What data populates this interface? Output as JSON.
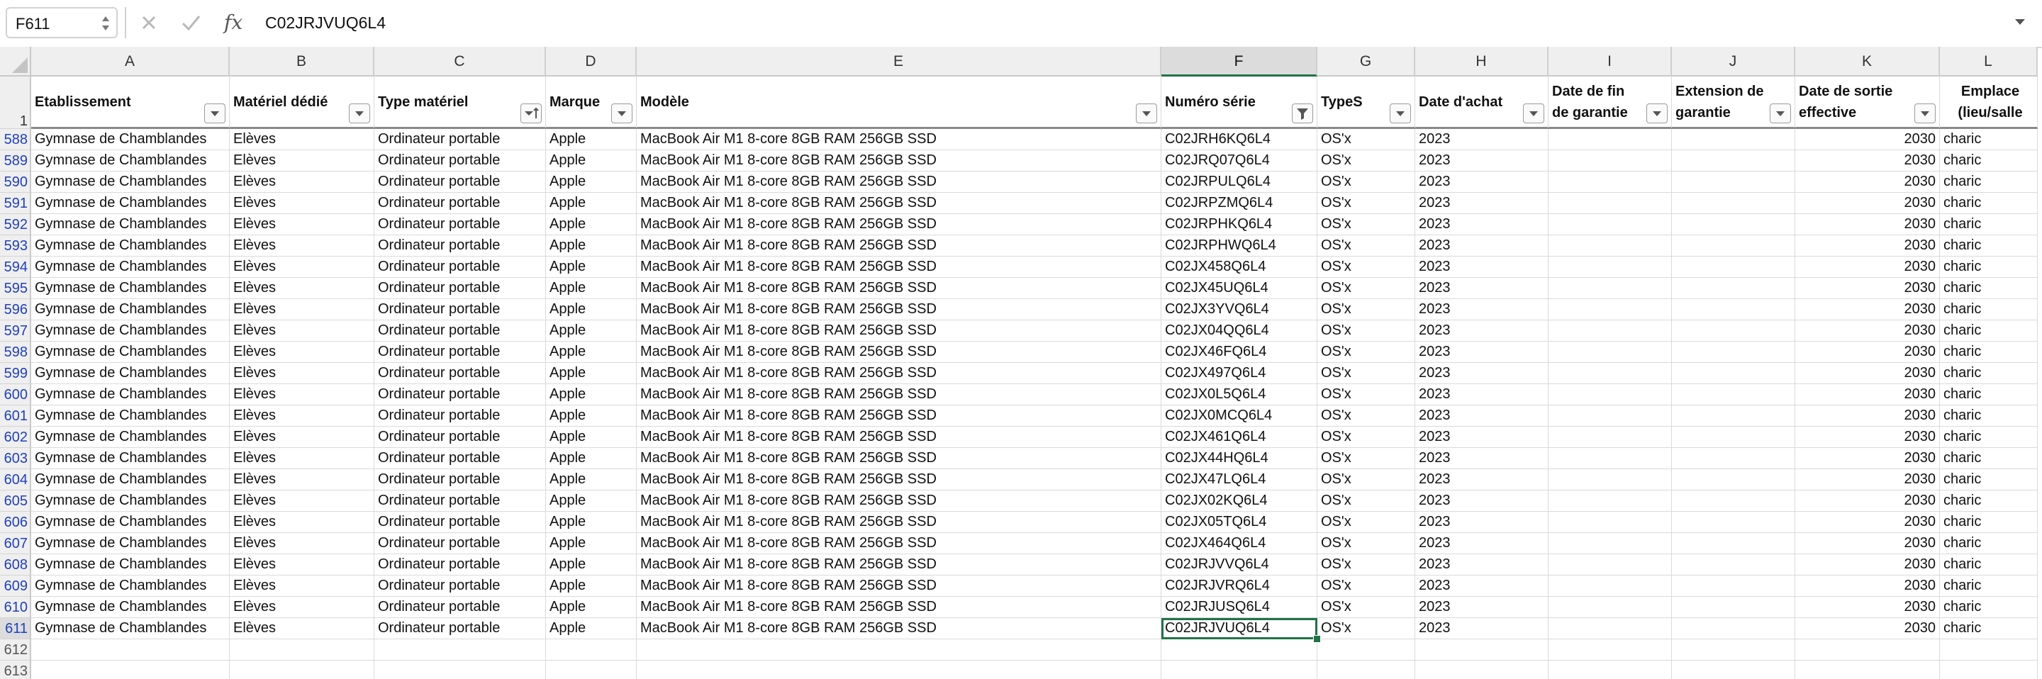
{
  "formula_bar": {
    "name_box": "F611",
    "cancel_icon": "close-icon",
    "enter_icon": "check-icon",
    "fx_label": "fx",
    "formula_value": "C02JRJVUQ6L4"
  },
  "columns": [
    {
      "letter": "A",
      "header": "Etablissement"
    },
    {
      "letter": "B",
      "header": "Matériel dédié"
    },
    {
      "letter": "C",
      "header": "Type matériel"
    },
    {
      "letter": "D",
      "header": "Marque"
    },
    {
      "letter": "E",
      "header": "Modèle"
    },
    {
      "letter": "F",
      "header": "Numéro série"
    },
    {
      "letter": "G",
      "header": "TypeS"
    },
    {
      "letter": "H",
      "header": "Date d'achat"
    },
    {
      "letter": "I",
      "header": "Date de fin de garantie"
    },
    {
      "letter": "J",
      "header": "Extension de garantie"
    },
    {
      "letter": "K",
      "header": "Date de sortie effective"
    },
    {
      "letter": "L",
      "header": "Emplace (lieu/salle"
    }
  ],
  "header_row_number": "1",
  "selected_cell": {
    "column": "F",
    "row": "611"
  },
  "rows": [
    {
      "n": "588",
      "cells": [
        "Gymnase de Chamblandes",
        "Elèves",
        "Ordinateur portable",
        "Apple",
        "MacBook Air M1 8-core 8GB RAM 256GB SSD",
        "C02JRH6KQ6L4",
        "OS'x",
        "2023",
        "",
        "",
        "2030",
        "charic"
      ]
    },
    {
      "n": "589",
      "cells": [
        "Gymnase de Chamblandes",
        "Elèves",
        "Ordinateur portable",
        "Apple",
        "MacBook Air M1 8-core 8GB RAM 256GB SSD",
        "C02JRQ07Q6L4",
        "OS'x",
        "2023",
        "",
        "",
        "2030",
        "charic"
      ]
    },
    {
      "n": "590",
      "cells": [
        "Gymnase de Chamblandes",
        "Elèves",
        "Ordinateur portable",
        "Apple",
        "MacBook Air M1 8-core 8GB RAM 256GB SSD",
        "C02JRPULQ6L4",
        "OS'x",
        "2023",
        "",
        "",
        "2030",
        "charic"
      ]
    },
    {
      "n": "591",
      "cells": [
        "Gymnase de Chamblandes",
        "Elèves",
        "Ordinateur portable",
        "Apple",
        "MacBook Air M1 8-core 8GB RAM 256GB SSD",
        "C02JRPZMQ6L4",
        "OS'x",
        "2023",
        "",
        "",
        "2030",
        "charic"
      ]
    },
    {
      "n": "592",
      "cells": [
        "Gymnase de Chamblandes",
        "Elèves",
        "Ordinateur portable",
        "Apple",
        "MacBook Air M1 8-core 8GB RAM 256GB SSD",
        "C02JRPHKQ6L4",
        "OS'x",
        "2023",
        "",
        "",
        "2030",
        "charic"
      ]
    },
    {
      "n": "593",
      "cells": [
        "Gymnase de Chamblandes",
        "Elèves",
        "Ordinateur portable",
        "Apple",
        "MacBook Air M1 8-core 8GB RAM 256GB SSD",
        "C02JRPHWQ6L4",
        "OS'x",
        "2023",
        "",
        "",
        "2030",
        "charic"
      ]
    },
    {
      "n": "594",
      "cells": [
        "Gymnase de Chamblandes",
        "Elèves",
        "Ordinateur portable",
        "Apple",
        "MacBook Air M1 8-core 8GB RAM 256GB SSD",
        "C02JX458Q6L4",
        "OS'x",
        "2023",
        "",
        "",
        "2030",
        "charic"
      ]
    },
    {
      "n": "595",
      "cells": [
        "Gymnase de Chamblandes",
        "Elèves",
        "Ordinateur portable",
        "Apple",
        "MacBook Air M1 8-core 8GB RAM 256GB SSD",
        "C02JX45UQ6L4",
        "OS'x",
        "2023",
        "",
        "",
        "2030",
        "charic"
      ]
    },
    {
      "n": "596",
      "cells": [
        "Gymnase de Chamblandes",
        "Elèves",
        "Ordinateur portable",
        "Apple",
        "MacBook Air M1 8-core 8GB RAM 256GB SSD",
        "C02JX3YVQ6L4",
        "OS'x",
        "2023",
        "",
        "",
        "2030",
        "charic"
      ]
    },
    {
      "n": "597",
      "cells": [
        "Gymnase de Chamblandes",
        "Elèves",
        "Ordinateur portable",
        "Apple",
        "MacBook Air M1 8-core 8GB RAM 256GB SSD",
        "C02JX04QQ6L4",
        "OS'x",
        "2023",
        "",
        "",
        "2030",
        "charic"
      ]
    },
    {
      "n": "598",
      "cells": [
        "Gymnase de Chamblandes",
        "Elèves",
        "Ordinateur portable",
        "Apple",
        "MacBook Air M1 8-core 8GB RAM 256GB SSD",
        "C02JX46FQ6L4",
        "OS'x",
        "2023",
        "",
        "",
        "2030",
        "charic"
      ]
    },
    {
      "n": "599",
      "cells": [
        "Gymnase de Chamblandes",
        "Elèves",
        "Ordinateur portable",
        "Apple",
        "MacBook Air M1 8-core 8GB RAM 256GB SSD",
        "C02JX497Q6L4",
        "OS'x",
        "2023",
        "",
        "",
        "2030",
        "charic"
      ]
    },
    {
      "n": "600",
      "cells": [
        "Gymnase de Chamblandes",
        "Elèves",
        "Ordinateur portable",
        "Apple",
        "MacBook Air M1 8-core 8GB RAM 256GB SSD",
        "C02JX0L5Q6L4",
        "OS'x",
        "2023",
        "",
        "",
        "2030",
        "charic"
      ]
    },
    {
      "n": "601",
      "cells": [
        "Gymnase de Chamblandes",
        "Elèves",
        "Ordinateur portable",
        "Apple",
        "MacBook Air M1 8-core 8GB RAM 256GB SSD",
        "C02JX0MCQ6L4",
        "OS'x",
        "2023",
        "",
        "",
        "2030",
        "charic"
      ]
    },
    {
      "n": "602",
      "cells": [
        "Gymnase de Chamblandes",
        "Elèves",
        "Ordinateur portable",
        "Apple",
        "MacBook Air M1 8-core 8GB RAM 256GB SSD",
        "C02JX461Q6L4",
        "OS'x",
        "2023",
        "",
        "",
        "2030",
        "charic"
      ]
    },
    {
      "n": "603",
      "cells": [
        "Gymnase de Chamblandes",
        "Elèves",
        "Ordinateur portable",
        "Apple",
        "MacBook Air M1 8-core 8GB RAM 256GB SSD",
        "C02JX44HQ6L4",
        "OS'x",
        "2023",
        "",
        "",
        "2030",
        "charic"
      ]
    },
    {
      "n": "604",
      "cells": [
        "Gymnase de Chamblandes",
        "Elèves",
        "Ordinateur portable",
        "Apple",
        "MacBook Air M1 8-core 8GB RAM 256GB SSD",
        "C02JX47LQ6L4",
        "OS'x",
        "2023",
        "",
        "",
        "2030",
        "charic"
      ]
    },
    {
      "n": "605",
      "cells": [
        "Gymnase de Chamblandes",
        "Elèves",
        "Ordinateur portable",
        "Apple",
        "MacBook Air M1 8-core 8GB RAM 256GB SSD",
        "C02JX02KQ6L4",
        "OS'x",
        "2023",
        "",
        "",
        "2030",
        "charic"
      ]
    },
    {
      "n": "606",
      "cells": [
        "Gymnase de Chamblandes",
        "Elèves",
        "Ordinateur portable",
        "Apple",
        "MacBook Air M1 8-core 8GB RAM 256GB SSD",
        "C02JX05TQ6L4",
        "OS'x",
        "2023",
        "",
        "",
        "2030",
        "charic"
      ]
    },
    {
      "n": "607",
      "cells": [
        "Gymnase de Chamblandes",
        "Elèves",
        "Ordinateur portable",
        "Apple",
        "MacBook Air M1 8-core 8GB RAM 256GB SSD",
        "C02JX464Q6L4",
        "OS'x",
        "2023",
        "",
        "",
        "2030",
        "charic"
      ]
    },
    {
      "n": "608",
      "cells": [
        "Gymnase de Chamblandes",
        "Elèves",
        "Ordinateur portable",
        "Apple",
        "MacBook Air M1 8-core 8GB RAM 256GB SSD",
        "C02JRJVVQ6L4",
        "OS'x",
        "2023",
        "",
        "",
        "2030",
        "charic"
      ]
    },
    {
      "n": "609",
      "cells": [
        "Gymnase de Chamblandes",
        "Elèves",
        "Ordinateur portable",
        "Apple",
        "MacBook Air M1 8-core 8GB RAM 256GB SSD",
        "C02JRJVRQ6L4",
        "OS'x",
        "2023",
        "",
        "",
        "2030",
        "charic"
      ]
    },
    {
      "n": "610",
      "cells": [
        "Gymnase de Chamblandes",
        "Elèves",
        "Ordinateur portable",
        "Apple",
        "MacBook Air M1 8-core 8GB RAM 256GB SSD",
        "C02JRJUSQ6L4",
        "OS'x",
        "2023",
        "",
        "",
        "2030",
        "charic"
      ]
    },
    {
      "n": "611",
      "cells": [
        "Gymnase de Chamblandes",
        "Elèves",
        "Ordinateur portable",
        "Apple",
        "MacBook Air M1 8-core 8GB RAM 256GB SSD",
        "C02JRJVUQ6L4",
        "OS'x",
        "2023",
        "",
        "",
        "2030",
        "charic"
      ]
    }
  ],
  "empty_rows": [
    "612",
    "613"
  ],
  "colors": {
    "accent_green": "#217346",
    "row_number_blue": "#1f3fbf"
  }
}
